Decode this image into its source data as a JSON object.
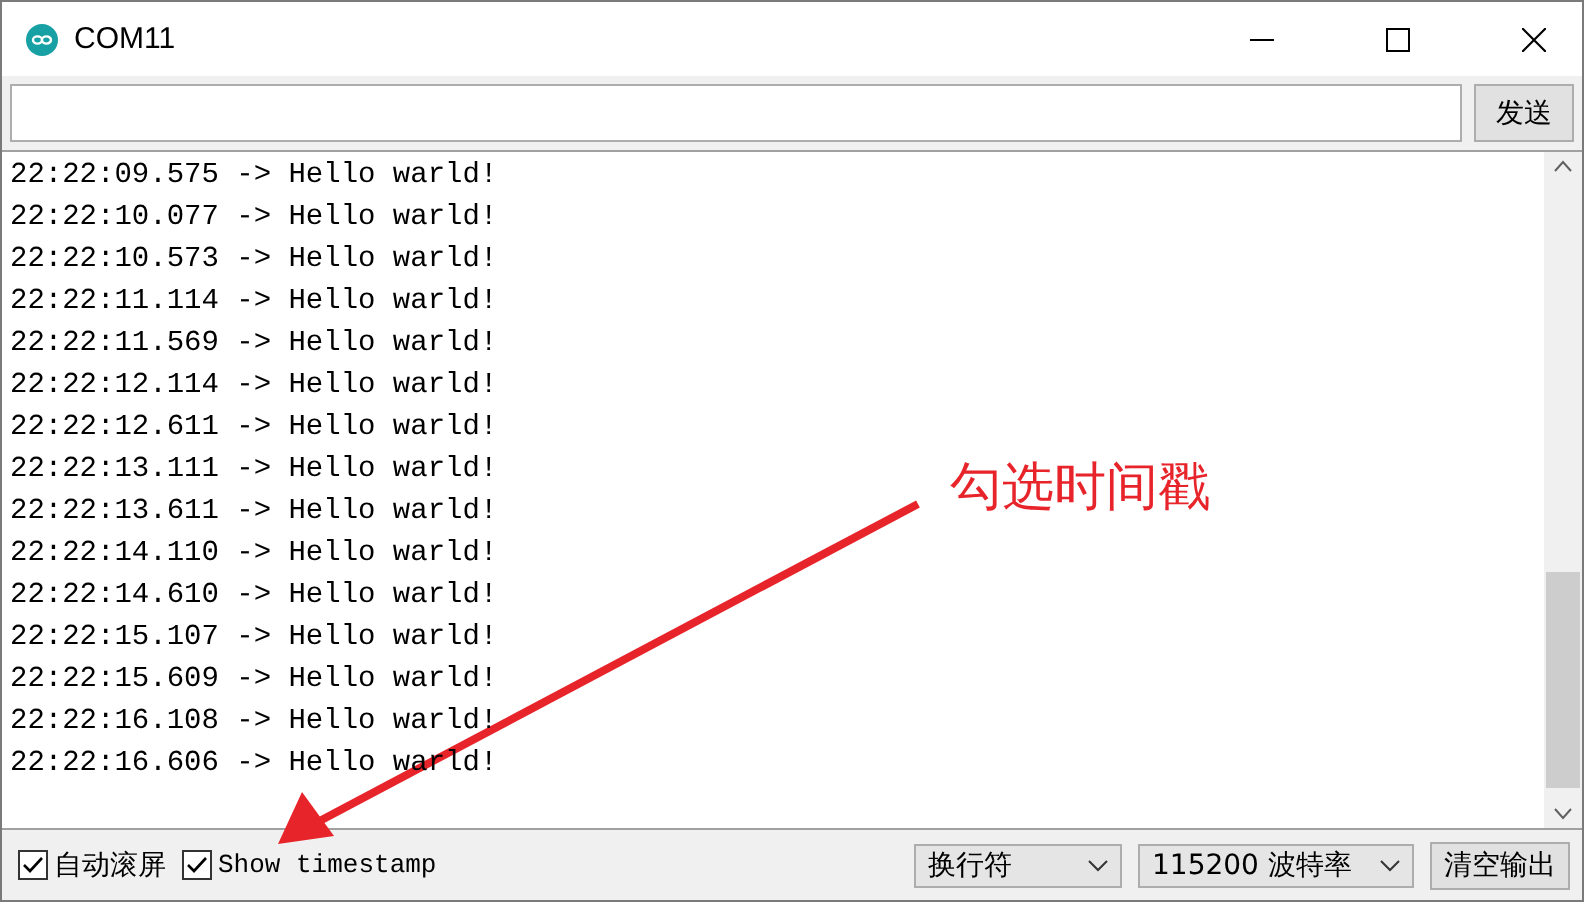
{
  "window": {
    "title": "COM11"
  },
  "send": {
    "button": "发送"
  },
  "log": [
    "22:22:09.575 -> Hello warld!",
    "22:22:10.077 -> Hello warld!",
    "22:22:10.573 -> Hello warld!",
    "22:22:11.114 -> Hello warld!",
    "22:22:11.569 -> Hello warld!",
    "22:22:12.114 -> Hello warld!",
    "22:22:12.611 -> Hello warld!",
    "22:22:13.111 -> Hello warld!",
    "22:22:13.611 -> Hello warld!",
    "22:22:14.110 -> Hello warld!",
    "22:22:14.610 -> Hello warld!",
    "22:22:15.107 -> Hello warld!",
    "22:22:15.609 -> Hello warld!",
    "22:22:16.108 -> Hello warld!",
    "22:22:16.606 -> Hello warld!"
  ],
  "bottom": {
    "autoscroll": {
      "label": "自动滚屏",
      "checked": true
    },
    "timestamp": {
      "label": "Show timestamp",
      "checked": true
    },
    "line_ending": "换行符",
    "baud": "115200 波特率",
    "clear": "清空输出"
  },
  "annotation": {
    "text": "勾选时间戳"
  }
}
